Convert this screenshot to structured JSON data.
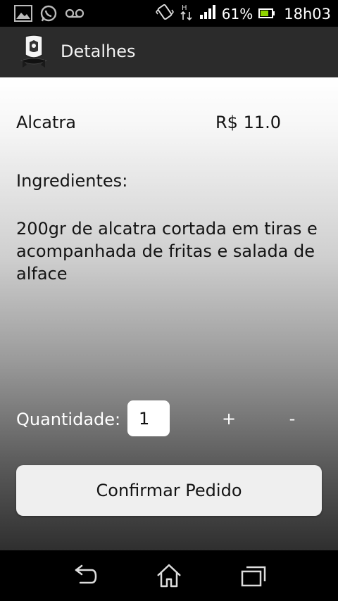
{
  "status_bar": {
    "battery": "61%",
    "time": "18h03",
    "icons": [
      "image-notification-icon",
      "whatsapp-icon",
      "voicemail-icon",
      "vibrate-icon",
      "hspa-data-icon",
      "signal-icon",
      "battery-icon"
    ]
  },
  "action_bar": {
    "title": "Detalhes",
    "icon": "app-logo-icon"
  },
  "product": {
    "name": "Alcatra",
    "price": "R$ 11.0",
    "ingredients_label": "Ingredientes:",
    "ingredients_text": "200gr de alcatra cortada em tiras e acompanhada de fritas e salada de alface"
  },
  "quantity": {
    "label": "Quantidade:",
    "value": "1",
    "plus_label": "+",
    "minus_label": "-"
  },
  "confirm": {
    "label": "Confirmar Pedido"
  },
  "nav_bar": {
    "icons": [
      "back-icon",
      "home-icon",
      "recent-apps-icon"
    ]
  },
  "colors": {
    "status_bg": "#000000",
    "action_bar_bg": "#2b2b2b",
    "button_bg": "#efefef"
  }
}
